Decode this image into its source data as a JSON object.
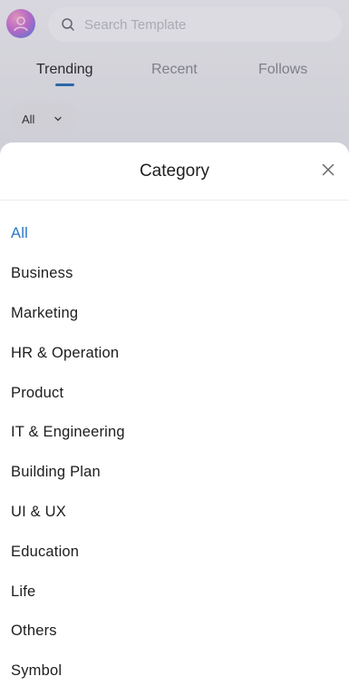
{
  "search": {
    "placeholder": "Search Template"
  },
  "tabs": [
    {
      "label": "Trending",
      "active": true
    },
    {
      "label": "Recent",
      "active": false
    },
    {
      "label": "Follows",
      "active": false
    }
  ],
  "filter": {
    "selected": "All"
  },
  "sheet": {
    "title": "Category",
    "items": [
      {
        "label": "All",
        "selected": true
      },
      {
        "label": "Business"
      },
      {
        "label": "Marketing"
      },
      {
        "label": "HR & Operation"
      },
      {
        "label": "Product"
      },
      {
        "label": "IT & Engineering"
      },
      {
        "label": "Building Plan"
      },
      {
        "label": "UI & UX"
      },
      {
        "label": "Education"
      },
      {
        "label": "Life"
      },
      {
        "label": "Others"
      },
      {
        "label": "Symbol"
      }
    ]
  },
  "colors": {
    "accent": "#2a78c4",
    "tab_indicator": "#2e6fb6"
  }
}
